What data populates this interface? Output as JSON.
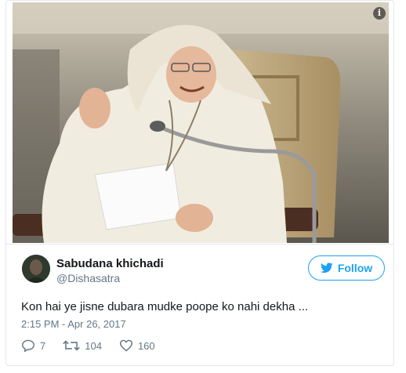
{
  "tweet": {
    "display_name": "Sabudana khichadi",
    "handle": "@Dishasatra",
    "follow_label": "Follow",
    "text": "Kon hai ye jisne dubara mudke poope ko nahi dekha ...",
    "timestamp": "2:15 PM - Apr 26, 2017",
    "replies": "7",
    "retweets": "104",
    "likes": "160"
  },
  "media": {
    "info_label": "i"
  },
  "colors": {
    "accent": "#1da1f2",
    "secondary_text": "#657786",
    "border": "#e1e8ed"
  },
  "icons": [
    "info-icon",
    "twitter-bird-icon",
    "reply-icon",
    "retweet-icon",
    "like-icon"
  ]
}
